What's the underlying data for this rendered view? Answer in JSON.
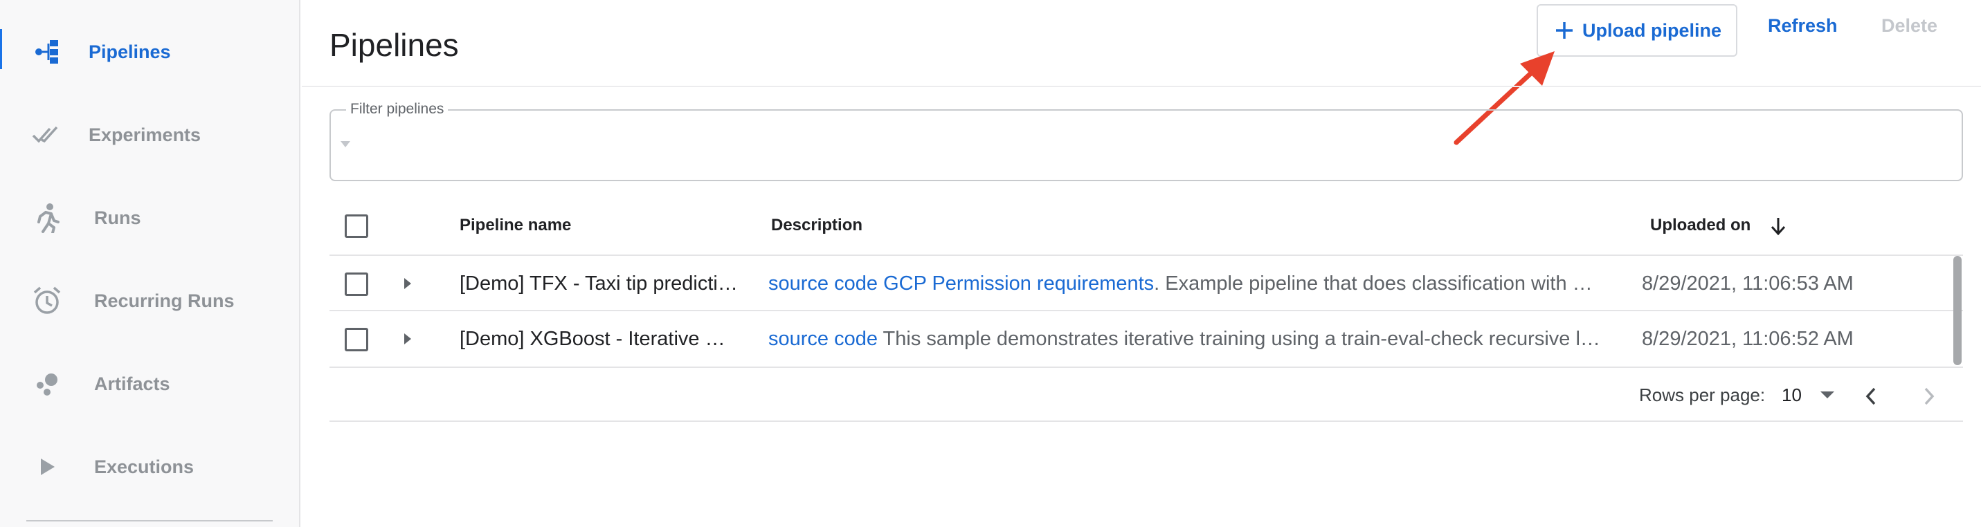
{
  "sidebar": {
    "items": [
      {
        "label": "Pipelines",
        "icon": "pipelines-icon",
        "active": true
      },
      {
        "label": "Experiments",
        "icon": "experiments-icon",
        "active": false
      },
      {
        "label": "Runs",
        "icon": "runs-icon",
        "active": false
      },
      {
        "label": "Recurring Runs",
        "icon": "alarm-clock-icon",
        "active": false
      },
      {
        "label": "Artifacts",
        "icon": "artifacts-icon",
        "active": false
      },
      {
        "label": "Executions",
        "icon": "play-icon",
        "active": false
      }
    ]
  },
  "header": {
    "title": "Pipelines",
    "upload_label": "Upload pipeline",
    "refresh_label": "Refresh",
    "delete_label": "Delete"
  },
  "filter": {
    "label": "Filter pipelines",
    "value": ""
  },
  "table": {
    "columns": {
      "name": "Pipeline name",
      "description": "Description",
      "uploaded": "Uploaded on"
    },
    "rows": [
      {
        "name": "[Demo] TFX - Taxi tip predicti…",
        "desc_link1": "source code",
        "desc_link2": "GCP Permission requirements",
        "desc_text": ". Example pipeline that does classification with …",
        "uploaded": "8/29/2021, 11:06:53 AM"
      },
      {
        "name": "[Demo] XGBoost - Iterative …",
        "desc_link1": "source code",
        "desc_link2": "",
        "desc_text": " This sample demonstrates iterative training using a train-eval-check recursive l…",
        "uploaded": "8/29/2021, 11:06:52 AM"
      }
    ]
  },
  "pagination": {
    "rows_per_page_label": "Rows per page:",
    "rows_per_page_value": "10"
  },
  "colors": {
    "accent": "#1a6ad3",
    "annotation_arrow": "#e8412c",
    "sidebar_bg": "#f8f8f9"
  }
}
